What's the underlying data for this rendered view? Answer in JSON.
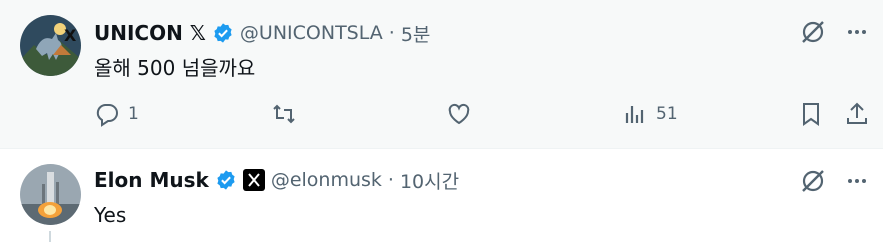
{
  "tweets": [
    {
      "display_name": "UNICON 𝕏",
      "handle": "@UNICONTSLA",
      "separator": "·",
      "time": "5분",
      "text": "올해 500  넘을까요",
      "verified": true,
      "stats": {
        "replies": "1",
        "views": "51"
      },
      "icons": [
        "reply-icon",
        "retweet-icon",
        "like-icon",
        "views-icon",
        "bookmark-icon",
        "share-icon",
        "grok-icon",
        "more-icon"
      ]
    },
    {
      "display_name": "Elon Musk",
      "handle": "@elonmusk",
      "separator": "·",
      "time": "10시간",
      "text": "Yes",
      "verified": true,
      "affiliation": "x-logo-badge",
      "icons": [
        "grok-icon",
        "more-icon"
      ]
    }
  ],
  "colors": {
    "verified_blue": "#1d9bf0",
    "secondary_text": "#536471",
    "hover_bg": "#f7f9f9"
  }
}
